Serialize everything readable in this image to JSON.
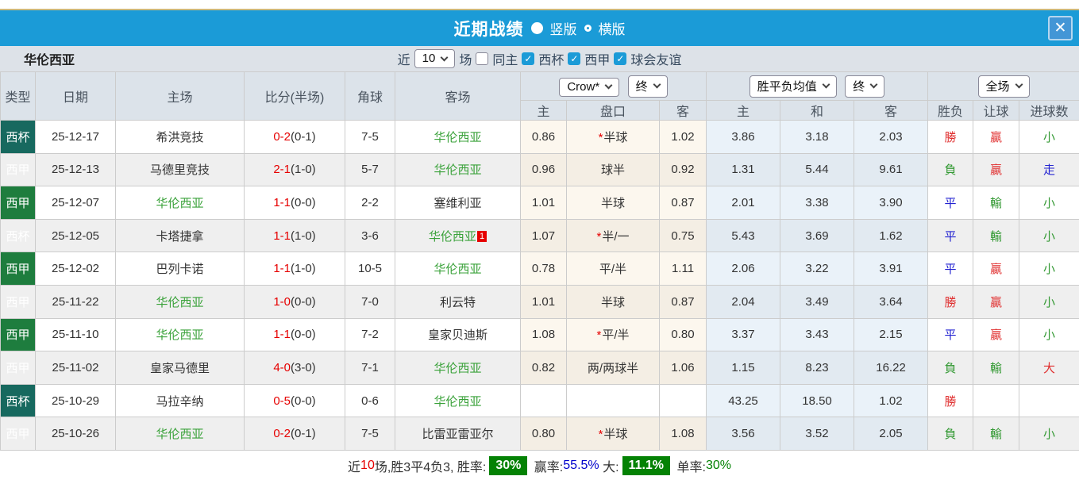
{
  "titlebar": {
    "title": "近期战绩",
    "radio_vertical_label": "竖版",
    "radio_horizontal_label": "横版",
    "close_label": "✕"
  },
  "filter": {
    "team": "华伦西亚",
    "near_label": "近",
    "count_value": "10",
    "games_label": "场",
    "same_home_label": "同主",
    "checkboxes": [
      {
        "label": "西杯",
        "checked": true
      },
      {
        "label": "西甲",
        "checked": true
      },
      {
        "label": "球会友谊",
        "checked": true
      }
    ]
  },
  "table": {
    "headers": {
      "type": "类型",
      "date": "日期",
      "home": "主场",
      "score": "比分(半场)",
      "corner": "角球",
      "away": "客场",
      "odds_home": "主",
      "odds_line": "盘口",
      "odds_away": "客",
      "avg_home": "主",
      "avg_draw": "和",
      "avg_away": "客",
      "result": "胜负",
      "handicap_result": "让球",
      "goals": "进球数"
    },
    "selects": {
      "bookmaker": "Crow*",
      "bookmaker_time": "终",
      "avg_label": "胜平负均值",
      "avg_time": "终",
      "scope": "全场"
    },
    "rows": [
      {
        "type": "西杯",
        "cup": true,
        "date": "25-12-17",
        "home": "希洪竞技",
        "home_self": false,
        "ft": "0-2",
        "ht": "(0-1)",
        "corner": "7-5",
        "away": "华伦西亚",
        "away_self": true,
        "badge": "",
        "o1": "0.86",
        "star": true,
        "line": "半球",
        "o2": "1.02",
        "m1": "3.86",
        "m2": "3.18",
        "m3": "2.03",
        "r1": "勝",
        "c1": "r",
        "r2": "贏",
        "c2": "r",
        "r3": "小",
        "c3": "g"
      },
      {
        "type": "西甲",
        "cup": false,
        "date": "25-12-13",
        "home": "马德里竞技",
        "home_self": false,
        "ft": "2-1",
        "ht": "(1-0)",
        "corner": "5-7",
        "away": "华伦西亚",
        "away_self": true,
        "badge": "",
        "o1": "0.96",
        "star": false,
        "line": "球半",
        "o2": "0.92",
        "m1": "1.31",
        "m2": "5.44",
        "m3": "9.61",
        "r1": "負",
        "c1": "g",
        "r2": "贏",
        "c2": "r",
        "r3": "走",
        "c3": "b"
      },
      {
        "type": "西甲",
        "cup": false,
        "date": "25-12-07",
        "home": "华伦西亚",
        "home_self": true,
        "ft": "1-1",
        "ht": "(0-0)",
        "corner": "2-2",
        "away": "塞维利亚",
        "away_self": false,
        "badge": "",
        "o1": "1.01",
        "star": false,
        "line": "半球",
        "o2": "0.87",
        "m1": "2.01",
        "m2": "3.38",
        "m3": "3.90",
        "r1": "平",
        "c1": "b",
        "r2": "輸",
        "c2": "g",
        "r3": "小",
        "c3": "g"
      },
      {
        "type": "西杯",
        "cup": true,
        "date": "25-12-05",
        "home": "卡塔捷拿",
        "home_self": false,
        "ft": "1-1",
        "ht": "(1-0)",
        "corner": "3-6",
        "away": "华伦西亚",
        "away_self": true,
        "badge": "1",
        "o1": "1.07",
        "star": true,
        "line": "半/一",
        "o2": "0.75",
        "m1": "5.43",
        "m2": "3.69",
        "m3": "1.62",
        "r1": "平",
        "c1": "b",
        "r2": "輸",
        "c2": "g",
        "r3": "小",
        "c3": "g"
      },
      {
        "type": "西甲",
        "cup": false,
        "date": "25-12-02",
        "home": "巴列卡诺",
        "home_self": false,
        "ft": "1-1",
        "ht": "(1-0)",
        "corner": "10-5",
        "away": "华伦西亚",
        "away_self": true,
        "badge": "",
        "o1": "0.78",
        "star": false,
        "line": "平/半",
        "o2": "1.11",
        "m1": "2.06",
        "m2": "3.22",
        "m3": "3.91",
        "r1": "平",
        "c1": "b",
        "r2": "贏",
        "c2": "r",
        "r3": "小",
        "c3": "g"
      },
      {
        "type": "西甲",
        "cup": false,
        "date": "25-11-22",
        "home": "华伦西亚",
        "home_self": true,
        "ft": "1-0",
        "ht": "(0-0)",
        "corner": "7-0",
        "away": "利云特",
        "away_self": false,
        "badge": "",
        "o1": "1.01",
        "star": false,
        "line": "半球",
        "o2": "0.87",
        "m1": "2.04",
        "m2": "3.49",
        "m3": "3.64",
        "r1": "勝",
        "c1": "r",
        "r2": "贏",
        "c2": "r",
        "r3": "小",
        "c3": "g"
      },
      {
        "type": "西甲",
        "cup": false,
        "date": "25-11-10",
        "home": "华伦西亚",
        "home_self": true,
        "ft": "1-1",
        "ht": "(0-0)",
        "corner": "7-2",
        "away": "皇家贝迪斯",
        "away_self": false,
        "badge": "",
        "o1": "1.08",
        "star": true,
        "line": "平/半",
        "o2": "0.80",
        "m1": "3.37",
        "m2": "3.43",
        "m3": "2.15",
        "r1": "平",
        "c1": "b",
        "r2": "贏",
        "c2": "r",
        "r3": "小",
        "c3": "g"
      },
      {
        "type": "西甲",
        "cup": false,
        "date": "25-11-02",
        "home": "皇家马德里",
        "home_self": false,
        "ft": "4-0",
        "ht": "(3-0)",
        "corner": "7-1",
        "away": "华伦西亚",
        "away_self": true,
        "badge": "",
        "o1": "0.82",
        "star": false,
        "line": "两/两球半",
        "o2": "1.06",
        "m1": "1.15",
        "m2": "8.23",
        "m3": "16.22",
        "r1": "負",
        "c1": "g",
        "r2": "輸",
        "c2": "g",
        "r3": "大",
        "c3": "r"
      },
      {
        "type": "西杯",
        "cup": true,
        "date": "25-10-29",
        "home": "马拉辛纳",
        "home_self": false,
        "ft": "0-5",
        "ht": "(0-0)",
        "corner": "0-6",
        "away": "华伦西亚",
        "away_self": true,
        "badge": "",
        "o1": "",
        "star": false,
        "line": "",
        "o2": "",
        "m1": "43.25",
        "m2": "18.50",
        "m3": "1.02",
        "r1": "勝",
        "c1": "r",
        "r2": "",
        "c2": "",
        "r3": "",
        "c3": ""
      },
      {
        "type": "西甲",
        "cup": false,
        "date": "25-10-26",
        "home": "华伦西亚",
        "home_self": true,
        "ft": "0-2",
        "ht": "(0-1)",
        "corner": "7-5",
        "away": "比雷亚雷亚尔",
        "away_self": false,
        "badge": "",
        "o1": "0.80",
        "star": true,
        "line": "半球",
        "o2": "1.08",
        "m1": "3.56",
        "m2": "3.52",
        "m3": "2.05",
        "r1": "負",
        "c1": "g",
        "r2": "輸",
        "c2": "g",
        "r3": "小",
        "c3": "g"
      }
    ]
  },
  "footer": {
    "parts": [
      {
        "text": "近"
      },
      {
        "text": "10"
      },
      {
        "text": "场,胜3平4负3, 胜率:"
      },
      {
        "text": "30%"
      },
      {
        "text": " 赢率:"
      },
      {
        "text": "55.5%"
      },
      {
        "text": " 大:"
      },
      {
        "text": "11.1%"
      },
      {
        "text": " 单率:"
      },
      {
        "text": "30%"
      }
    ]
  },
  "colors": {
    "titlebar_blue": "#1b9bd7",
    "cup_badge_teal": "#17695f",
    "league_badge_green": "#1e7d3e",
    "self_team_green": "#3aa23a",
    "score_red": "#e60000",
    "result_red": "#e03030",
    "result_green": "#339933",
    "result_blue": "#2323d1",
    "footer_box_green": "#048204",
    "footer_blue": "#0000cc"
  }
}
